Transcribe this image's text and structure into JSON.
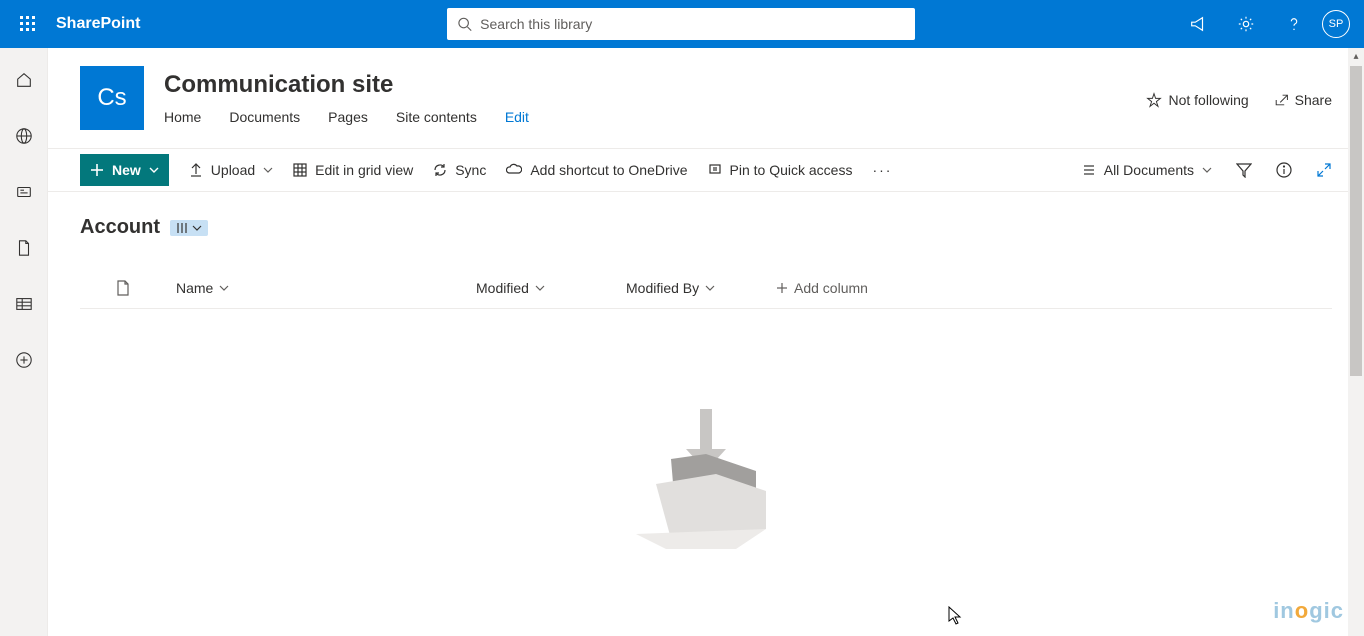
{
  "header": {
    "app_name": "SharePoint",
    "search_placeholder": "Search this library",
    "avatar_initials": "SP"
  },
  "site": {
    "logo_text": "Cs",
    "title": "Communication site",
    "nav": {
      "home": "Home",
      "documents": "Documents",
      "pages": "Pages",
      "site_contents": "Site contents",
      "edit": "Edit"
    },
    "actions": {
      "not_following": "Not following",
      "share": "Share"
    }
  },
  "cmdbar": {
    "new": "New",
    "upload": "Upload",
    "edit_grid": "Edit in grid view",
    "sync": "Sync",
    "shortcut": "Add shortcut to OneDrive",
    "pin": "Pin to Quick access",
    "view_name": "All Documents"
  },
  "library": {
    "title": "Account",
    "columns": {
      "name": "Name",
      "modified": "Modified",
      "modified_by": "Modified By",
      "add_column": "Add column"
    }
  },
  "watermark": {
    "brand": "inogic"
  }
}
